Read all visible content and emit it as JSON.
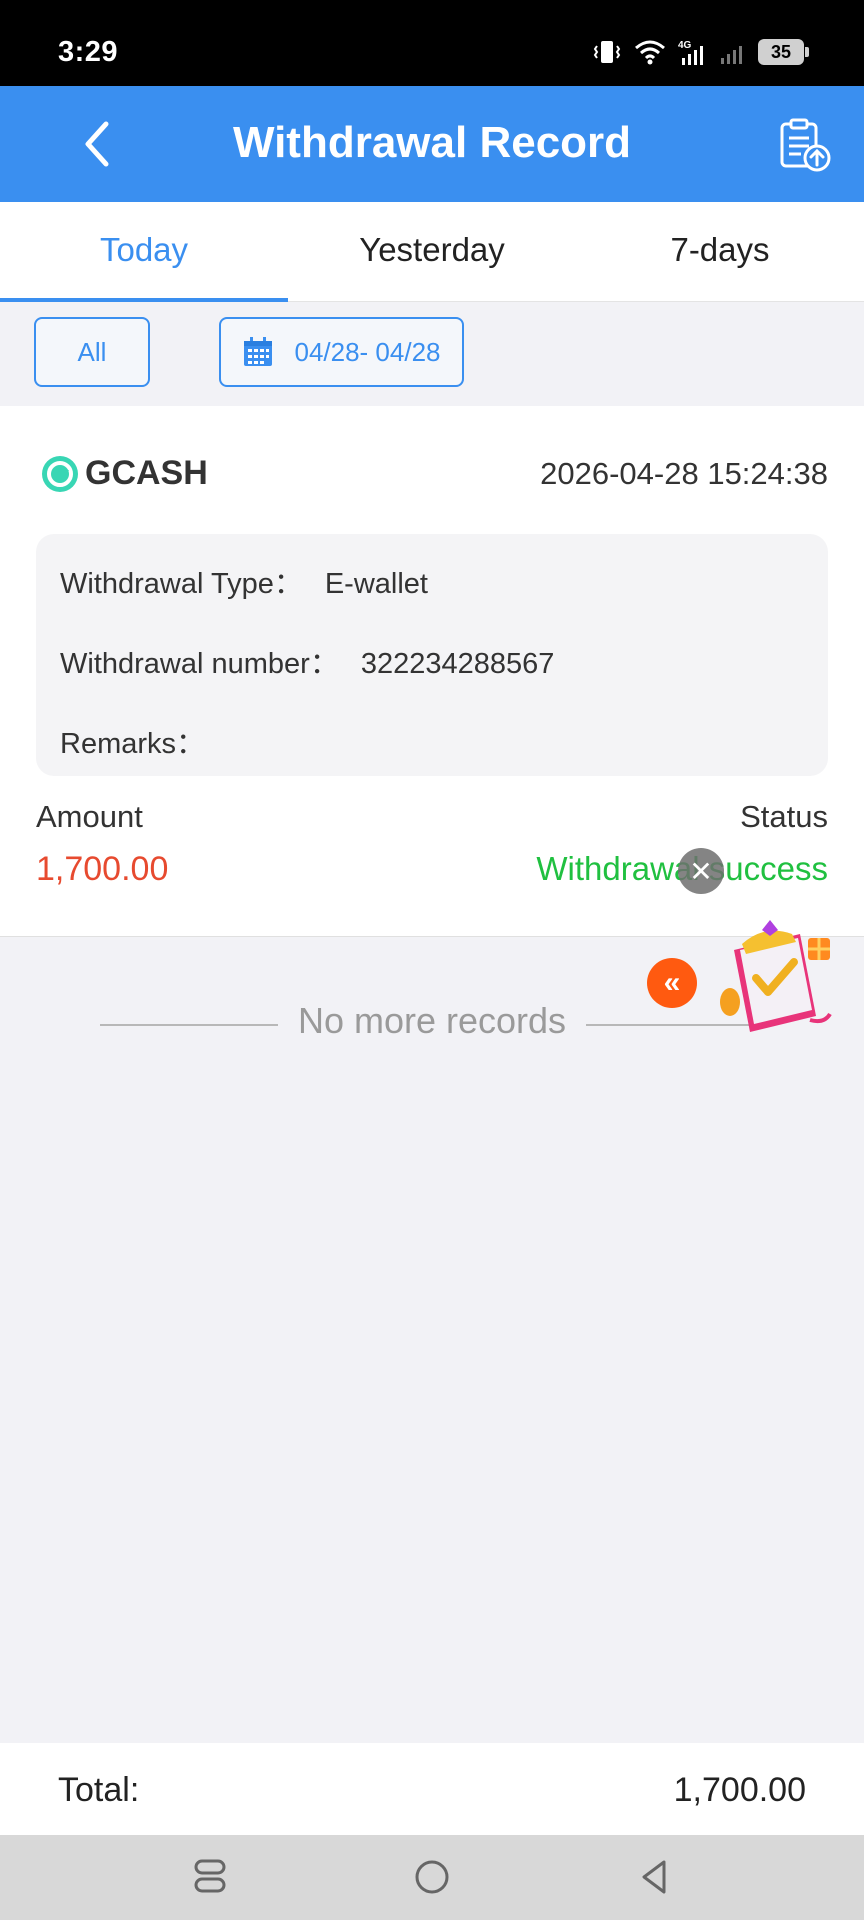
{
  "status_bar": {
    "time": "3:29",
    "network": "4G",
    "battery": "35"
  },
  "header": {
    "title": "Withdrawal Record",
    "back_icon": "chevron-left-icon",
    "upload_icon": "clipboard-upload-icon"
  },
  "tabs": [
    {
      "label": "Today",
      "active": true
    },
    {
      "label": "Yesterday",
      "active": false
    },
    {
      "label": "7-days",
      "active": false
    }
  ],
  "filters": {
    "all_label": "All",
    "date_range": "04/28- 04/28",
    "date_icon": "calendar-icon"
  },
  "record": {
    "method": "GCASH",
    "datetime": "2026-04-28 15:24:38",
    "withdrawal_type_label": "Withdrawal Type：",
    "withdrawal_type_value": "E-wallet",
    "withdrawal_number_label": "Withdrawal number：",
    "withdrawal_number_value": "322234288567",
    "remarks_label": "Remarks：",
    "remarks_value": "",
    "amount_label": "Amount",
    "amount_value": "1,700.00",
    "status_label": "Status",
    "status_value": "Withdrawal success"
  },
  "list_end": "No more records",
  "total": {
    "label": "Total:",
    "value": "1,700.00"
  },
  "colors": {
    "primary": "#3a8ff0",
    "amount": "#e74a2f",
    "success": "#20c040"
  }
}
